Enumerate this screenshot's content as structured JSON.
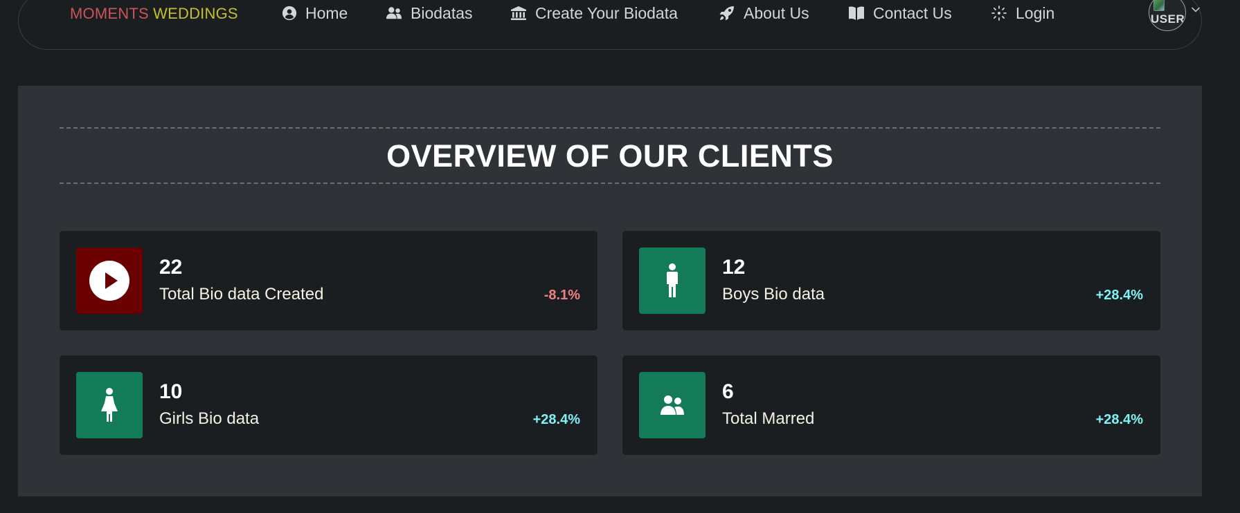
{
  "brand": {
    "part1": "MOMENTS",
    "part2": "WEDDINGS",
    "color_part1": "#c9555a",
    "color_part2": "#c2c12b"
  },
  "nav": {
    "items": [
      {
        "label": "Home",
        "icon": "user-circle-icon"
      },
      {
        "label": "Biodatas",
        "icon": "users-icon"
      },
      {
        "label": "Create Your Biodata",
        "icon": "bank-icon"
      },
      {
        "label": "About Us",
        "icon": "rocket-icon"
      },
      {
        "label": "Contact Us",
        "icon": "book-open-icon"
      },
      {
        "label": "Login",
        "icon": "login-icon"
      }
    ],
    "avatar_alt": "USER"
  },
  "overview": {
    "title": "OVERVIEW OF OUR CLIENTS",
    "cards": [
      {
        "number": "22",
        "label": "Total Bio data Created",
        "change": "-8.1%",
        "icon": "play-circle-icon",
        "icon_bg": "#6b0000",
        "change_color": "#f08080"
      },
      {
        "number": "12",
        "label": "Boys Bio data",
        "change": "+28.4%",
        "icon": "male-icon",
        "icon_bg": "#137b58",
        "change_color": "#7ff3f3"
      },
      {
        "number": "10",
        "label": "Girls Bio data",
        "change": "+28.4%",
        "icon": "female-icon",
        "icon_bg": "#137b58",
        "change_color": "#7ff3f3"
      },
      {
        "number": "6",
        "label": "Total Marred",
        "change": "+28.4%",
        "icon": "couple-icon",
        "icon_bg": "#137b58",
        "change_color": "#7ff3f3"
      }
    ]
  }
}
